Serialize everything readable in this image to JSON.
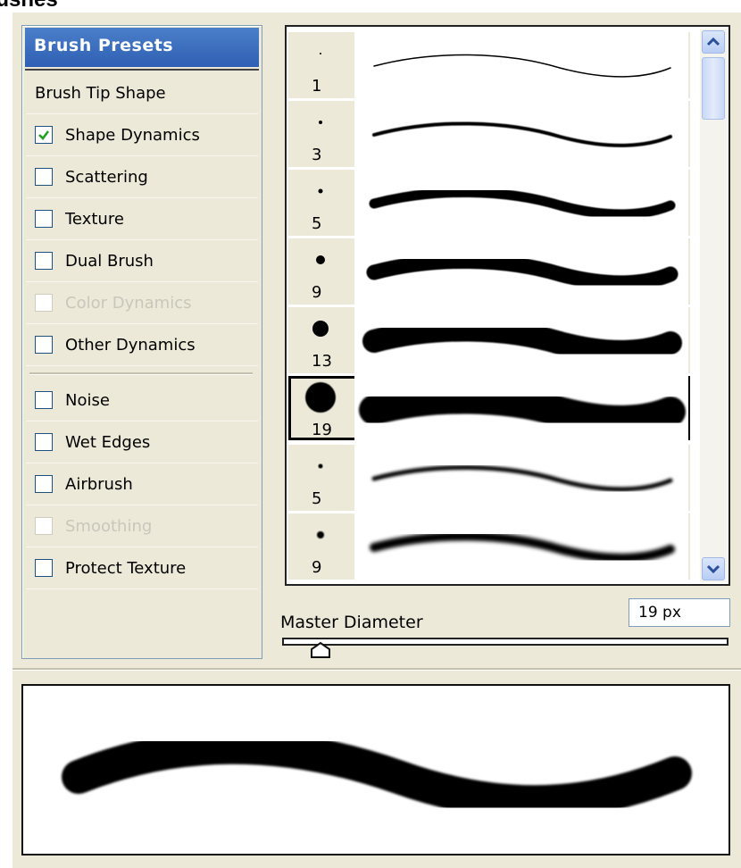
{
  "window": {
    "title": "rushes"
  },
  "options": {
    "header": "Brush Presets",
    "items": [
      {
        "label": "Brush Tip Shape",
        "checkbox": false,
        "checked": false,
        "enabled": true
      },
      {
        "label": "Shape Dynamics",
        "checkbox": true,
        "checked": true,
        "enabled": true
      },
      {
        "label": "Scattering",
        "checkbox": true,
        "checked": false,
        "enabled": true
      },
      {
        "label": "Texture",
        "checkbox": true,
        "checked": false,
        "enabled": true
      },
      {
        "label": "Dual Brush",
        "checkbox": true,
        "checked": false,
        "enabled": true
      },
      {
        "label": "Color Dynamics",
        "checkbox": true,
        "checked": false,
        "enabled": false
      },
      {
        "label": "Other Dynamics",
        "checkbox": true,
        "checked": false,
        "enabled": true
      },
      {
        "label": "Noise",
        "checkbox": true,
        "checked": false,
        "enabled": true
      },
      {
        "label": "Wet Edges",
        "checkbox": true,
        "checked": false,
        "enabled": true
      },
      {
        "label": "Airbrush",
        "checkbox": true,
        "checked": false,
        "enabled": true
      },
      {
        "label": "Smoothing",
        "checkbox": true,
        "checked": false,
        "enabled": false
      },
      {
        "label": "Protect Texture",
        "checkbox": true,
        "checked": false,
        "enabled": true
      }
    ]
  },
  "brushes": {
    "items": [
      {
        "size": "1",
        "selected": false
      },
      {
        "size": "3",
        "selected": false
      },
      {
        "size": "5",
        "selected": false
      },
      {
        "size": "9",
        "selected": false
      },
      {
        "size": "13",
        "selected": false
      },
      {
        "size": "19",
        "selected": true
      },
      {
        "size": "5",
        "selected": false
      },
      {
        "size": "9",
        "selected": false
      }
    ]
  },
  "master_diameter": {
    "label": "Master Diameter",
    "value": "19 px"
  },
  "colors": {
    "header_blue": "#2f5fb3",
    "panel_bg": "#ece9d8",
    "check_green": "#21a121"
  }
}
